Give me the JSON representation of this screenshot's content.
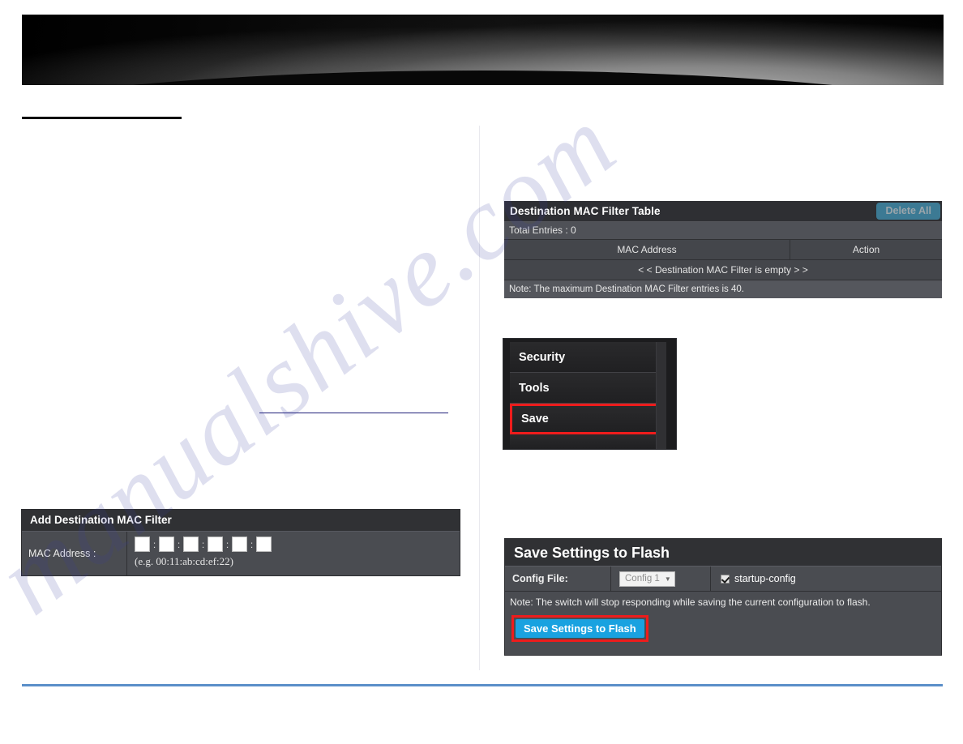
{
  "page": {
    "watermark": "manualshive.com"
  },
  "mac_filter_table": {
    "title": "Destination MAC Filter Table",
    "delete_all_label": "Delete All",
    "total_entries": "Total Entries : 0",
    "columns": [
      "MAC Address",
      "Action"
    ],
    "empty_message": "< < Destination MAC Filter is empty > >",
    "note": "Note: The maximum Destination MAC Filter entries is 40."
  },
  "side_menu": {
    "items": [
      {
        "label": "Security",
        "highlighted": false
      },
      {
        "label": "Tools",
        "highlighted": false
      },
      {
        "label": "Save",
        "highlighted": true
      }
    ],
    "highlight_color": "#ee1c1c"
  },
  "add_mac_filter": {
    "title": "Add Destination MAC Filter",
    "mac_label": "MAC Address :",
    "octet_values": [
      "",
      "",
      "",
      "",
      "",
      ""
    ],
    "separator": ":",
    "hint": "(e.g. 00:11:ab:cd:ef:22)"
  },
  "save_flash": {
    "title": "Save Settings to Flash",
    "config_file_label": "Config File:",
    "config_file_value": "Config 1",
    "config_file_options": [
      "Config 1"
    ],
    "startup_config_label": "startup-config",
    "startup_config_checked": true,
    "note": "Note: The switch will stop responding while saving the current configuration to flash.",
    "save_button_label": "Save Settings to Flash",
    "save_button_color": "#19a2e0",
    "highlight_color": "#ee1c1c"
  }
}
